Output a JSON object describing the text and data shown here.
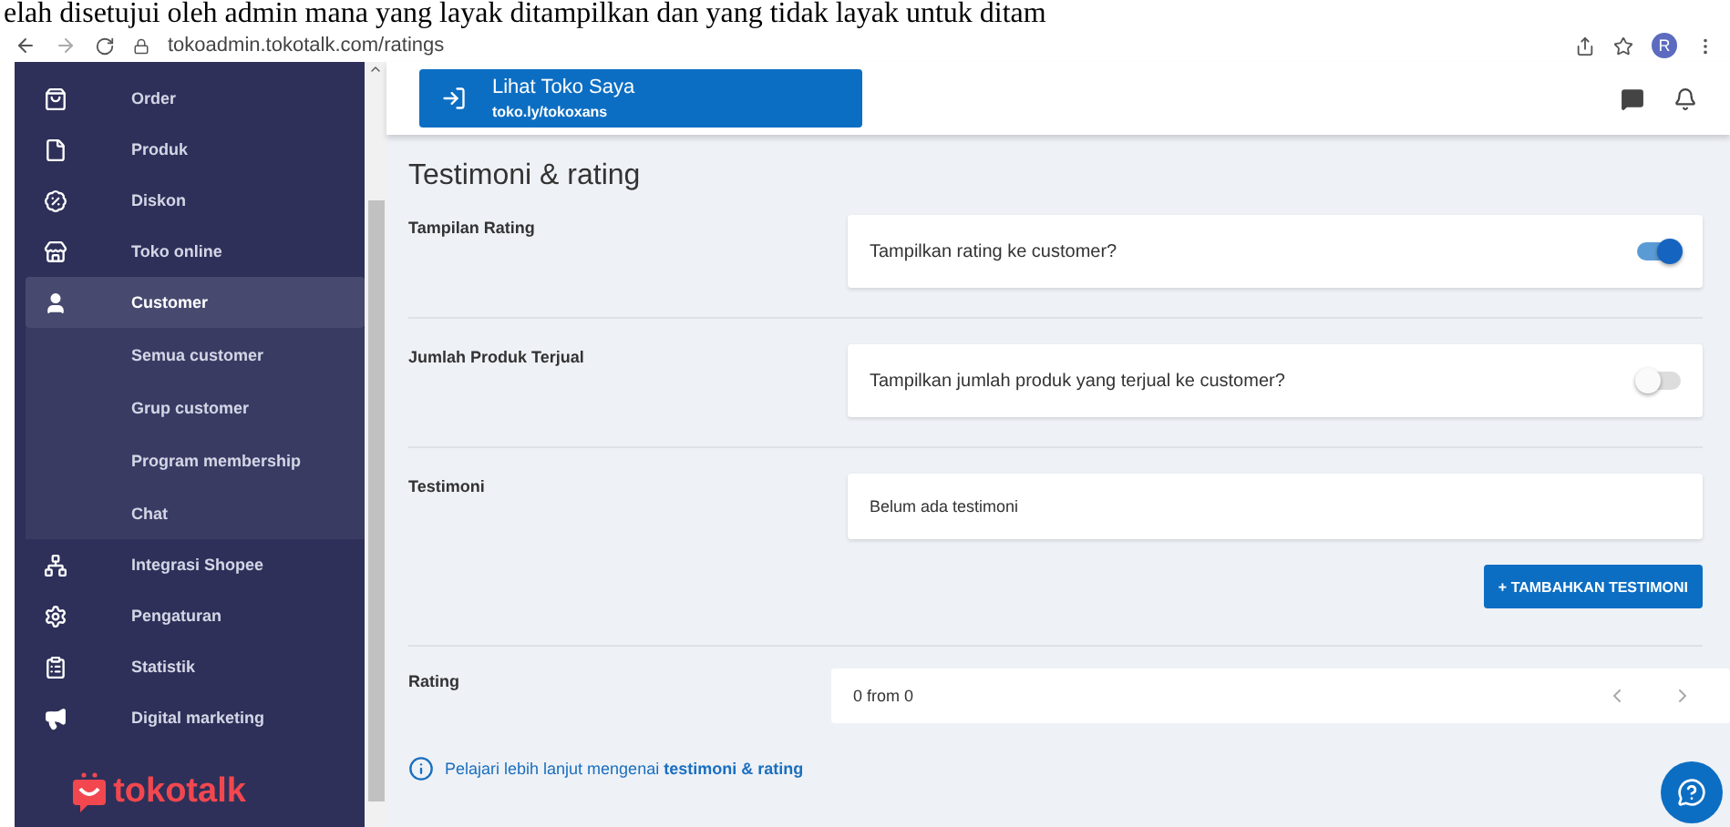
{
  "document_line": "elah disetujui oleh admin mana yang layak ditampilkan dan yang tidak layak untuk ditam",
  "browser": {
    "url": "tokoadmin.tokotalk.com/ratings",
    "profile_initial": "R"
  },
  "sidebar": {
    "items": [
      {
        "label": "Order",
        "selected": false
      },
      {
        "label": "Produk",
        "selected": false
      },
      {
        "label": "Diskon",
        "selected": false
      },
      {
        "label": "Toko online",
        "selected": false
      },
      {
        "label": "Customer",
        "selected": true,
        "expanded": true,
        "children": [
          {
            "label": "Semua customer"
          },
          {
            "label": "Grup customer"
          },
          {
            "label": "Program membership"
          },
          {
            "label": "Chat"
          }
        ]
      },
      {
        "label": "Integrasi Shopee",
        "selected": false
      },
      {
        "label": "Pengaturan",
        "selected": false
      },
      {
        "label": "Statistik",
        "selected": false
      },
      {
        "label": "Digital marketing",
        "selected": false
      }
    ],
    "logo": "tokotalk"
  },
  "header": {
    "store_button": {
      "title": "Lihat Toko Saya",
      "link": "toko.ly/tokoxans"
    }
  },
  "page_title": "Testimoni & rating",
  "sections": [
    {
      "kind": "toggle",
      "label": "Tampilan Rating",
      "question": "Tampilkan rating ke customer?",
      "on": true
    },
    {
      "kind": "toggle",
      "label": "Jumlah Produk Terjual",
      "question": "Tampilkan jumlah produk yang terjual ke customer?",
      "on": false
    },
    {
      "kind": "list",
      "label": "Testimoni",
      "empty_text": "Belum ada testimoni",
      "button": "+ TAMBAHKAN TESTIMONI"
    },
    {
      "kind": "pager",
      "label": "Rating",
      "count": "0 from 0"
    }
  ],
  "help_link": "Pelajari lebih lanjut mengenai **testimoni & rating**"
}
